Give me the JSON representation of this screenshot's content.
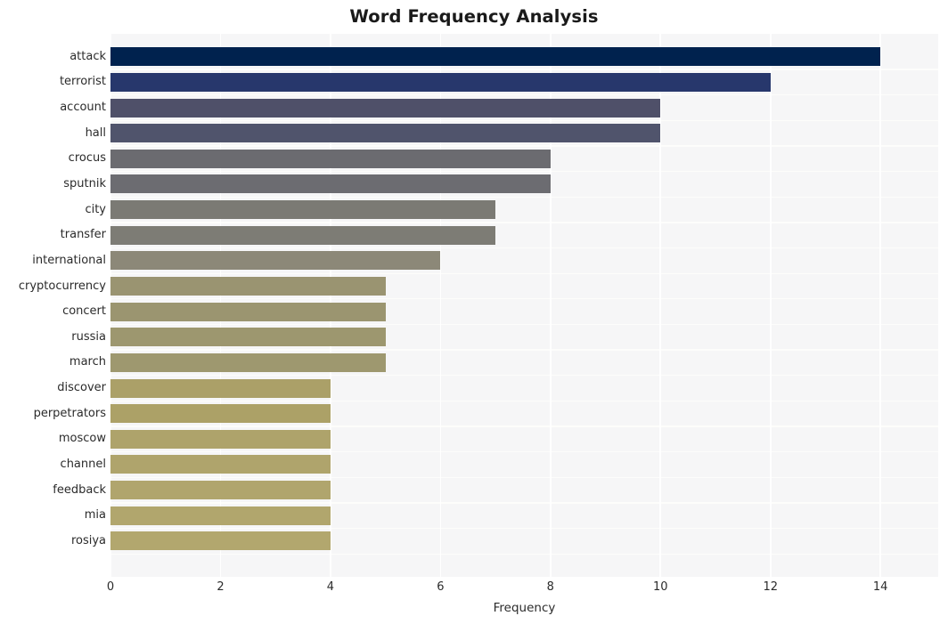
{
  "chart_data": {
    "type": "bar",
    "orientation": "horizontal",
    "title": "Word Frequency Analysis",
    "xlabel": "Frequency",
    "ylabel": "",
    "xlim": [
      0,
      15.05
    ],
    "ylim": [
      0,
      20
    ],
    "grid": true,
    "legend": null,
    "xticks": [
      "0",
      "2",
      "4",
      "6",
      "8",
      "10",
      "12",
      "14"
    ],
    "xtick_values": [
      0,
      2,
      4,
      6,
      8,
      10,
      12,
      14
    ],
    "categories": [
      "attack",
      "terrorist",
      "account",
      "hall",
      "crocus",
      "sputnik",
      "city",
      "transfer",
      "international",
      "cryptocurrency",
      "concert",
      "russia",
      "march",
      "discover",
      "perpetrators",
      "moscow",
      "channel",
      "feedback",
      "mia",
      "rosiya"
    ],
    "values": [
      14,
      12,
      10,
      10,
      8,
      8,
      7,
      7,
      6,
      5,
      5,
      5,
      5,
      4,
      4,
      4,
      4,
      4,
      4,
      4
    ],
    "bar_colors": [
      "#00224e",
      "#27376c",
      "#4f5069",
      "#50546c",
      "#6b6b70",
      "#6c6c71",
      "#7b7a74",
      "#7d7c75",
      "#8c8878",
      "#9a9471",
      "#9b9570",
      "#9d976f",
      "#9e986f",
      "#aba068",
      "#ac a167",
      "#aea36b",
      "#afa46c",
      "#b0a56d",
      "#b1a66d",
      "#b2a76e"
    ],
    "plot_background": "#f6f6f7",
    "gridline_color": "#ffffff",
    "figure_background": "#ffffff"
  }
}
